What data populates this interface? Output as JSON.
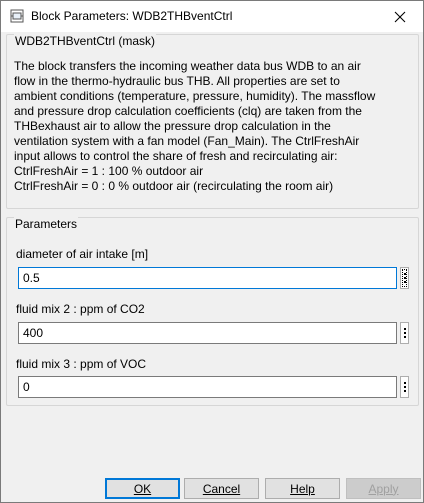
{
  "window": {
    "title": "Block Parameters: WDB2THBventCtrl",
    "close_glyph": "✕"
  },
  "mask": {
    "group_title": "WDB2THBventCtrl (mask)",
    "description_lines": [
      "The block transfers the incoming weather data bus WDB to an air",
      "flow in the thermo-hydraulic bus THB. All properties are set to",
      "ambient conditions (temperature, pressure, humidity). The massflow",
      "and pressure drop calculation coefficients (clq) are taken from the",
      "THBexhaust air to allow the pressure drop calculation in the",
      "ventilation system with a fan model (Fan_Main). The CtrlFreshAir",
      "input allows to control the share of fresh and recirculating air:",
      "CtrlFreshAir = 1 : 100 % outdoor air",
      "CtrlFreshAir = 0 : 0 % outdoor air (recirculating the room air)"
    ]
  },
  "parameters": {
    "group_title": "Parameters",
    "items": [
      {
        "label": "diameter of air intake [m]",
        "value": "0.5"
      },
      {
        "label": "fluid mix 2 : ppm of CO2",
        "value": "400"
      },
      {
        "label": "fluid mix 3 : ppm of VOC",
        "value": "0"
      }
    ]
  },
  "buttons": {
    "ok": "OK",
    "cancel": "Cancel",
    "help": "Help",
    "apply": "Apply"
  },
  "icons": {
    "app": "simulink-block-icon",
    "close": "close-icon",
    "more": "vertical-dots-icon"
  },
  "colors": {
    "accent": "#0078d7",
    "window_bg": "#f0f0f0",
    "titlebar_bg": "#ffffff"
  }
}
